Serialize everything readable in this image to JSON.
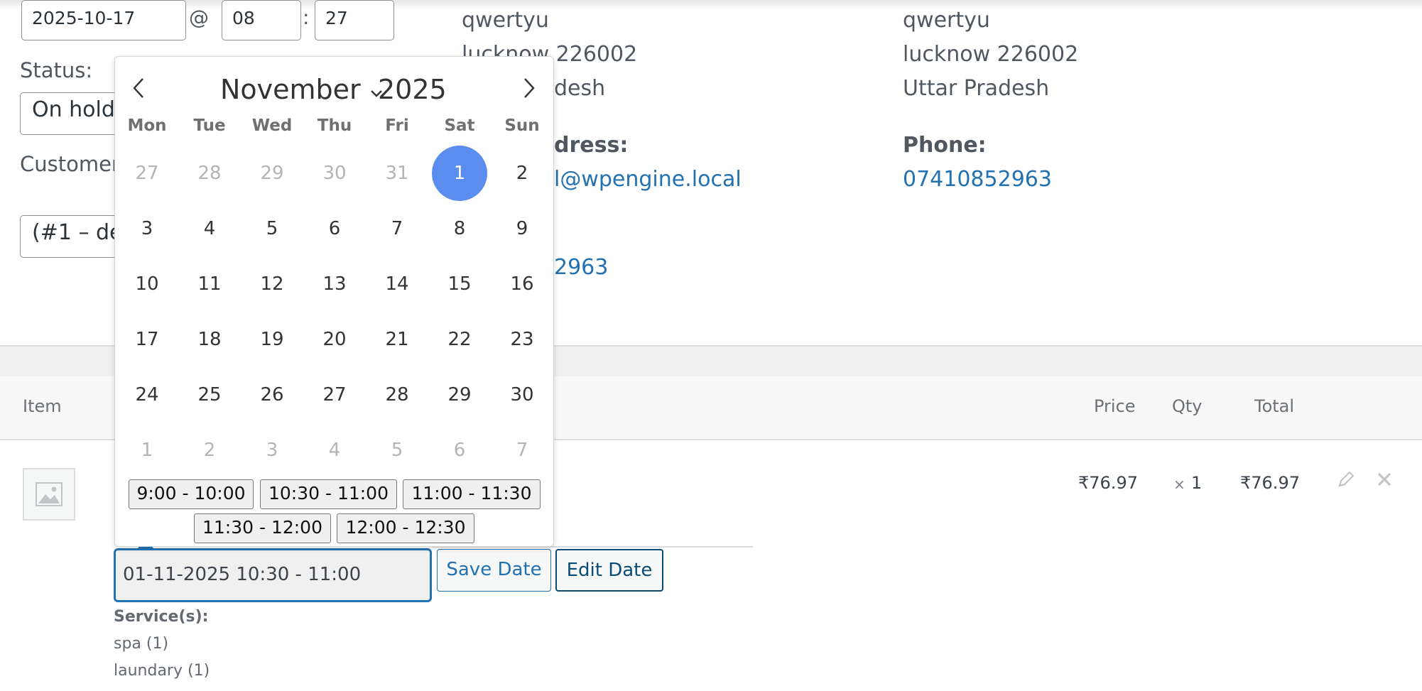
{
  "order": {
    "date": "2025-10-17",
    "at": "@",
    "hour": "08",
    "colon": ":",
    "minute": "27",
    "status_label": "Status:",
    "status_value": "On hold",
    "customer_label": "Customer",
    "customer_value": "(#1 – de"
  },
  "billing": {
    "line1": "qwertyu",
    "line2": "lucknow 226002",
    "line3": "desh",
    "email_label": "dress:",
    "email_value": "l@wpengine.local",
    "phone_partial": "2963"
  },
  "shipping": {
    "line1": "qwertyu",
    "line2": "lucknow 226002",
    "line3": "Uttar Pradesh",
    "phone_label": "Phone:",
    "phone_value": "07410852963"
  },
  "calendar": {
    "month": "November",
    "year": "2025",
    "prev": "‹",
    "next": "›",
    "weekdays": [
      "Mon",
      "Tue",
      "Wed",
      "Thu",
      "Fri",
      "Sat",
      "Sun"
    ],
    "weeks": [
      [
        "27",
        "28",
        "29",
        "30",
        "31",
        "1",
        "2"
      ],
      [
        "3",
        "4",
        "5",
        "6",
        "7",
        "8",
        "9"
      ],
      [
        "10",
        "11",
        "12",
        "13",
        "14",
        "15",
        "16"
      ],
      [
        "17",
        "18",
        "19",
        "20",
        "21",
        "22",
        "23"
      ],
      [
        "24",
        "25",
        "26",
        "27",
        "28",
        "29",
        "30"
      ],
      [
        "1",
        "2",
        "3",
        "4",
        "5",
        "6",
        "7"
      ]
    ],
    "selected_day": "1",
    "time_slots": [
      "9:00 - 10:00",
      "10:30 - 11:00",
      "11:00 - 11:30",
      "11:30 - 12:00",
      "12:00 - 12:30"
    ]
  },
  "items_table": {
    "col_item": "Item",
    "col_price": "Price",
    "col_qty": "Qty",
    "col_total": "Total",
    "row": {
      "price": "₹76.97",
      "qty_symbol": "×",
      "qty": "1",
      "total": "₹76.97"
    }
  },
  "booking": {
    "date_value": "01-11-2025 10:30 - 11:00",
    "save_label": "Save Date",
    "edit_label": "Edit Date",
    "services_label": "Service(s):",
    "services": [
      "spa (1)",
      "laundary (1)"
    ]
  },
  "colors": {
    "accent": "#2271b1",
    "selected_day": "#5b8def"
  }
}
